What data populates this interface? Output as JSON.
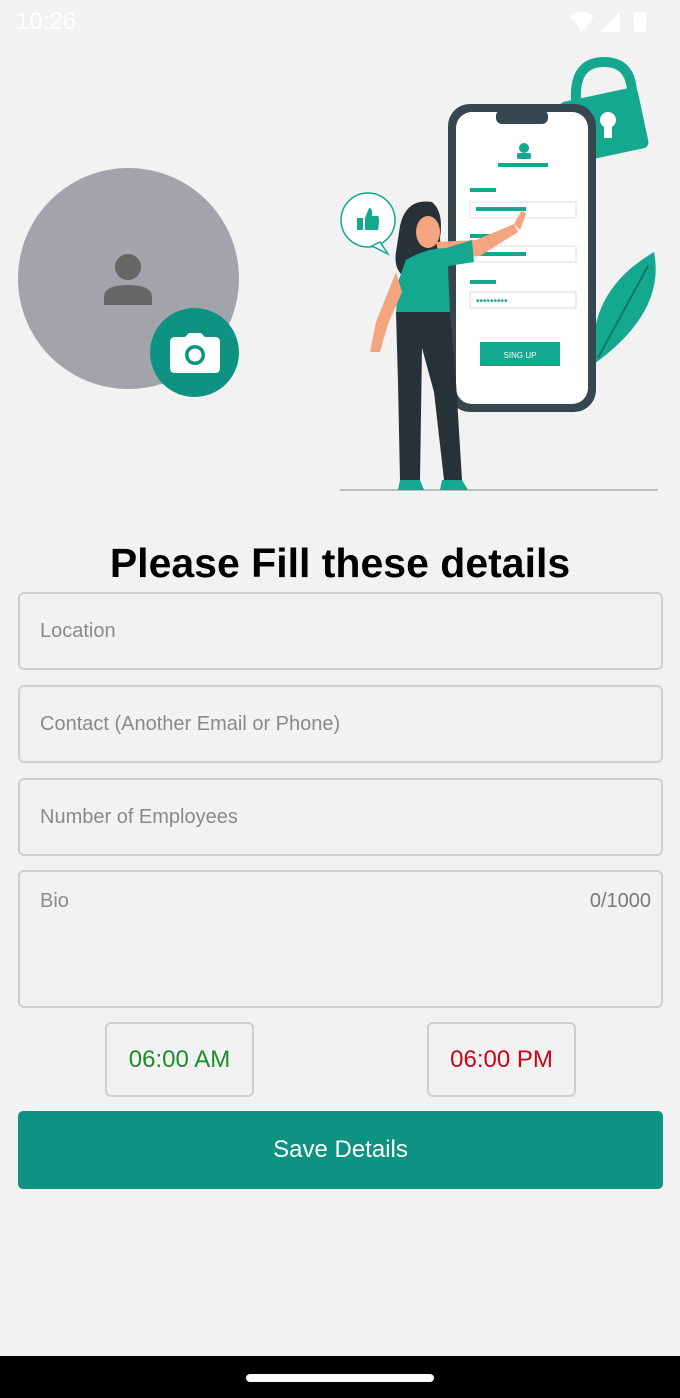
{
  "status_bar": {
    "time": "10:26",
    "icons": [
      "wifi-icon",
      "signal-icon",
      "battery-icon"
    ]
  },
  "profile": {
    "avatar_icon": "person-icon",
    "camera_icon": "camera-icon"
  },
  "illustration": {
    "button_label": "SING UP"
  },
  "form": {
    "heading": "Please Fill these details",
    "location_placeholder": "Location",
    "contact_placeholder": "Contact (Another Email or Phone)",
    "employees_placeholder": "Number of Employees",
    "bio_placeholder": "Bio",
    "bio_counter": "0/1000",
    "start_time": "06:00 AM",
    "end_time": "06:00 PM",
    "save_label": "Save Details"
  },
  "colors": {
    "accent": "#0e9383",
    "start_time": "#1e8c2e",
    "end_time": "#d0021b",
    "avatar": "#a3a3aa",
    "background": "#f2f2f2"
  }
}
